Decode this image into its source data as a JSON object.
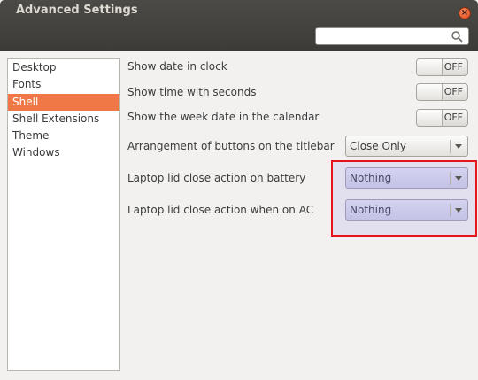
{
  "window": {
    "title": "Advanced Settings",
    "close_glyph": "×"
  },
  "search": {
    "placeholder": "",
    "value": "",
    "icon": "search-icon"
  },
  "sidebar": {
    "items": [
      {
        "label": "Desktop"
      },
      {
        "label": "Fonts"
      },
      {
        "label": "Shell",
        "selected": true
      },
      {
        "label": "Shell Extensions"
      },
      {
        "label": "Theme"
      },
      {
        "label": "Windows"
      }
    ]
  },
  "settings": {
    "show_date": {
      "label": "Show date in clock",
      "state": "OFF"
    },
    "show_seconds": {
      "label": "Show time with seconds",
      "state": "OFF"
    },
    "show_week": {
      "label": "Show the week date in the calendar",
      "state": "OFF"
    },
    "titlebar_buttons": {
      "label": "Arrangement of buttons on the titlebar",
      "value": "Close Only"
    },
    "lid_battery": {
      "label": "Laptop lid close action on battery",
      "value": "Nothing"
    },
    "lid_ac": {
      "label": "Laptop lid close action when on AC",
      "value": "Nothing"
    }
  },
  "colors": {
    "accent": "#f07746",
    "highlight_border": "#e8141c",
    "titlebar": "#3c3b37"
  }
}
